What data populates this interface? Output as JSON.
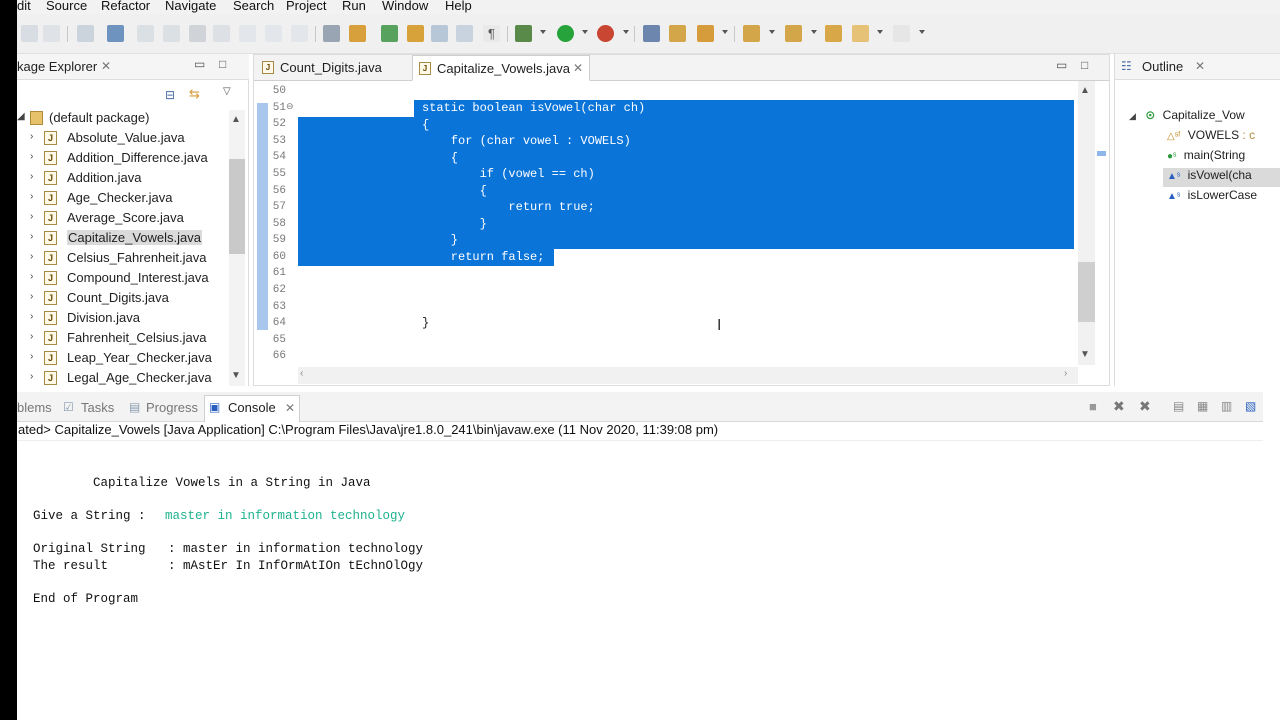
{
  "menu": [
    "dit",
    "Source",
    "Refactor",
    "Navigate",
    "Search",
    "Project",
    "Run",
    "Window",
    "Help"
  ],
  "package_explorer": {
    "title": "kage Explorer",
    "tree": [
      {
        "label": "(default package)",
        "type": "package",
        "expanded": true
      },
      {
        "label": "Absolute_Value.java"
      },
      {
        "label": "Addition_Difference.java"
      },
      {
        "label": "Addition.java"
      },
      {
        "label": "Age_Checker.java"
      },
      {
        "label": "Average_Score.java"
      },
      {
        "label": "Capitalize_Vowels.java",
        "selected": true
      },
      {
        "label": "Celsius_Fahrenheit.java"
      },
      {
        "label": "Compound_Interest.java"
      },
      {
        "label": "Count_Digits.java"
      },
      {
        "label": "Division.java"
      },
      {
        "label": "Fahrenheit_Celsius.java"
      },
      {
        "label": "Leap_Year_Checker.java"
      },
      {
        "label": "Legal_Age_Checker.java"
      }
    ]
  },
  "editor": {
    "tabs": [
      {
        "label": "Count_Digits.java",
        "active": false
      },
      {
        "label": "Capitalize_Vowels.java",
        "active": true
      }
    ],
    "line_numbers": [
      "50",
      "51",
      "52",
      "53",
      "54",
      "55",
      "56",
      "57",
      "58",
      "59",
      "60",
      "61",
      "62",
      "63",
      "64",
      "65",
      "66"
    ],
    "code_lines": [
      "",
      "static boolean isVowel(char ch)",
      "{",
      "    for (char vowel : VOWELS)",
      "    {",
      "        if (vowel == ch)",
      "        {",
      "            return true;",
      "        }",
      "    }",
      "    return false;",
      "",
      "",
      "",
      "}",
      "",
      ""
    ]
  },
  "outline": {
    "title": "Outline",
    "items": [
      {
        "label": "Capitalize_Vow"
      },
      {
        "label": "VOWELS",
        "suffix": ": c"
      },
      {
        "label": "main(String"
      },
      {
        "label": "isVowel(cha",
        "selected": true
      },
      {
        "label": "isLowerCase"
      }
    ]
  },
  "console": {
    "tabs": [
      "blems",
      "Tasks",
      "Progress",
      "Console"
    ],
    "path": "ated> Capitalize_Vowels [Java Application] C:\\Program Files\\Java\\jre1.8.0_241\\bin\\javaw.exe (11 Nov 2020, 11:39:08 pm)",
    "output": {
      "header": "        Capitalize Vowels in a String in Java",
      "prompt": "Give a String :  ",
      "input": "master in information technology",
      "original": "Original String   : master in information technology",
      "result": "The result        : mAstEr In InfOrmAtIOn tEchnOlOgy",
      "end": "End of Program"
    }
  },
  "colors": {
    "selection": "#0a74d8",
    "input_text": "#1fb28f"
  }
}
